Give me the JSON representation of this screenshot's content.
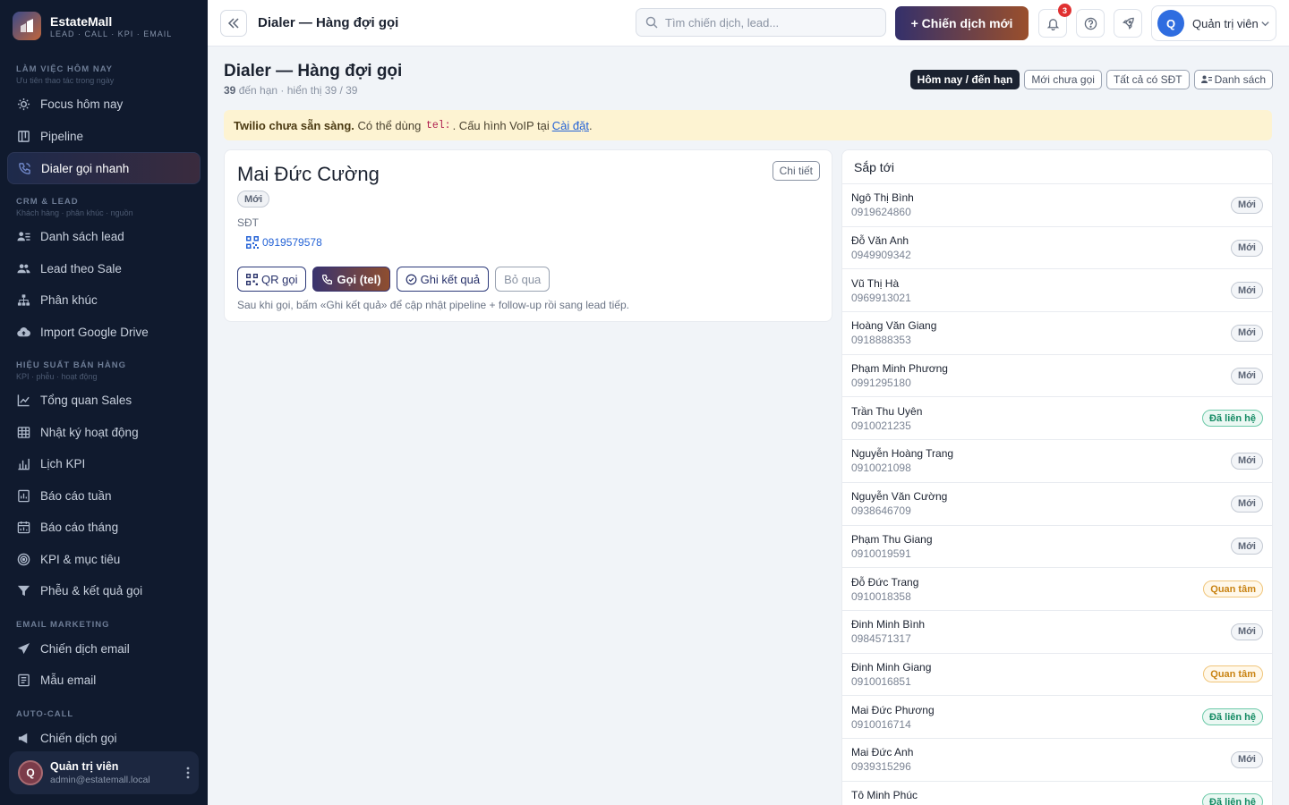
{
  "brand": {
    "name": "EstateMall",
    "tagline": "LEAD · CALL · KPI · EMAIL"
  },
  "nav": {
    "section1": {
      "title": "LÀM VIỆC HÔM NAY",
      "sub": "Ưu tiên thao tác trong ngày"
    },
    "focus": "Focus hôm nay",
    "pipeline": "Pipeline",
    "dialer": "Dialer gọi nhanh",
    "section2": {
      "title": "CRM & LEAD",
      "sub": "Khách hàng · phân khúc · nguồn"
    },
    "lead_list": "Danh sách lead",
    "lead_by_sale": "Lead theo Sale",
    "segments": "Phân khúc",
    "import_drive": "Import Google Drive",
    "section3": {
      "title": "HIỆU SUẤT BÁN HÀNG",
      "sub": "KPI · phễu · hoạt động"
    },
    "sales_overview": "Tổng quan Sales",
    "activity_log": "Nhật ký hoạt động",
    "kpi_calendar": "Lịch KPI",
    "weekly_report": "Báo cáo tuần",
    "monthly_report": "Báo cáo tháng",
    "kpi_targets": "KPI & mục tiêu",
    "funnel": "Phễu & kết quả gọi",
    "section4": {
      "title": "EMAIL MARKETING"
    },
    "email_campaigns": "Chiến dịch email",
    "email_templates": "Mẫu email",
    "section5": {
      "title": "AUTO-CALL"
    },
    "auto_call_campaigns": "Chiến dịch gọi"
  },
  "sidebar_user": {
    "initial": "Q",
    "name": "Quản trị viên",
    "email": "admin@estatemall.local"
  },
  "topbar": {
    "title": "Dialer — Hàng đợi gọi",
    "search_placeholder": "Tìm chiến dịch, lead...",
    "new_campaign": "+ Chiến dịch mới",
    "notification_count": "3",
    "user_initial": "Q",
    "user_name": "Quản trị viên"
  },
  "page": {
    "title": "Dialer — Hàng đợi gọi",
    "due_count": "39",
    "sub_rest": "đến hạn · hiển thị 39 / 39",
    "filters": {
      "today": "Hôm nay / đến hạn",
      "new_uncalled": "Mới chưa gọi",
      "all_phone": "Tất cả có SĐT",
      "list": "Danh sách"
    }
  },
  "alert": {
    "bold": "Twilio chưa sẵn sàng.",
    "text1": "Có thể dùng",
    "code": "tel:",
    "text2": ". Cấu hình VoIP tại",
    "link": "Cài đặt",
    "end": "."
  },
  "current_lead": {
    "name": "Mai Đức Cường",
    "detail_btn": "Chi tiết",
    "status": "Mới",
    "phone_label": "SĐT",
    "phone": "0919579578",
    "actions": {
      "qr": "QR gọi",
      "call": "Gọi (tel)",
      "log": "Ghi kết quả",
      "skip": "Bỏ qua"
    },
    "hint": "Sau khi gọi, bấm «Ghi kết quả» để cập nhật pipeline + follow-up rồi sang lead tiếp."
  },
  "upcoming": {
    "title": "Sắp tới",
    "rows": [
      {
        "name": "Ngô Thị Bình",
        "phone": "0919624860",
        "status": "Mới",
        "kind": "new"
      },
      {
        "name": "Đỗ Văn Anh",
        "phone": "0949909342",
        "status": "Mới",
        "kind": "new"
      },
      {
        "name": "Vũ Thị Hà",
        "phone": "0969913021",
        "status": "Mới",
        "kind": "new"
      },
      {
        "name": "Hoàng Văn Giang",
        "phone": "0918888353",
        "status": "Mới",
        "kind": "new"
      },
      {
        "name": "Phạm Minh Phương",
        "phone": "0991295180",
        "status": "Mới",
        "kind": "new"
      },
      {
        "name": "Trần Thu Uyên",
        "phone": "0910021235",
        "status": "Đã liên hệ",
        "kind": "contacted"
      },
      {
        "name": "Nguyễn Hoàng Trang",
        "phone": "0910021098",
        "status": "Mới",
        "kind": "new"
      },
      {
        "name": "Nguyễn Văn Cường",
        "phone": "0938646709",
        "status": "Mới",
        "kind": "new"
      },
      {
        "name": "Phạm Thu Giang",
        "phone": "0910019591",
        "status": "Mới",
        "kind": "new"
      },
      {
        "name": "Đỗ Đức Trang",
        "phone": "0910018358",
        "status": "Quan tâm",
        "kind": "interested"
      },
      {
        "name": "Đinh Minh Bình",
        "phone": "0984571317",
        "status": "Mới",
        "kind": "new"
      },
      {
        "name": "Đinh Minh Giang",
        "phone": "0910016851",
        "status": "Quan tâm",
        "kind": "interested"
      },
      {
        "name": "Mai Đức Phương",
        "phone": "0910016714",
        "status": "Đã liên hệ",
        "kind": "contacted"
      },
      {
        "name": "Mai Đức Anh",
        "phone": "0939315296",
        "status": "Mới",
        "kind": "new"
      },
      {
        "name": "Tô Minh Phúc",
        "phone": "0910016093",
        "status": "Đã liên hệ",
        "kind": "contacted"
      }
    ]
  }
}
